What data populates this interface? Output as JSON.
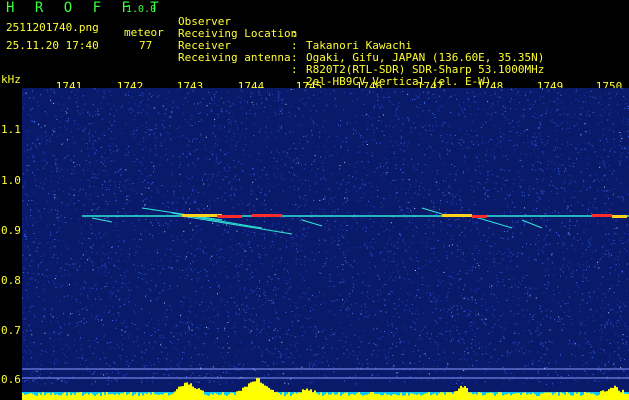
{
  "header": {
    "app_logo": "H R O F F T",
    "version": "1.0.0",
    "filename": "2511201740.png",
    "datetime": "25.11.20 17:40",
    "meteor_label": "meteor",
    "meteor_count": "77"
  },
  "info": [
    {
      "key": "Observer",
      "value": "Takanori Kawachi"
    },
    {
      "key": "Receiving Location",
      "value": "Ogaki, Gifu, JAPAN (136.60E, 35.35N)"
    },
    {
      "key": "Receiver",
      "value": "R820T2(RTL-SDR) SDR-Sharp 53.1000MHz"
    },
    {
      "key": "Receiving antenna",
      "value": "2el-HB9CV Vertical (el. E-W)"
    }
  ],
  "plot": {
    "y_unit": "kHz",
    "x_ticks": [
      "1741",
      "1742",
      "1743",
      "1744",
      "1745",
      "1746",
      "1747",
      "1748",
      "1749",
      "1750"
    ],
    "y_ticks": [
      "1.1",
      "1.0",
      "0.9",
      "0.8",
      "0.7",
      "0.6"
    ],
    "colors": {
      "background": "#0a1a6a",
      "noise": "#3b6cff",
      "carrier": "#2ee8d8",
      "echo_hot": "#ff2a2a",
      "echo_mid": "#ffd21a",
      "power_bar": "#ffff00",
      "power_base": "#00c8ff"
    }
  }
}
